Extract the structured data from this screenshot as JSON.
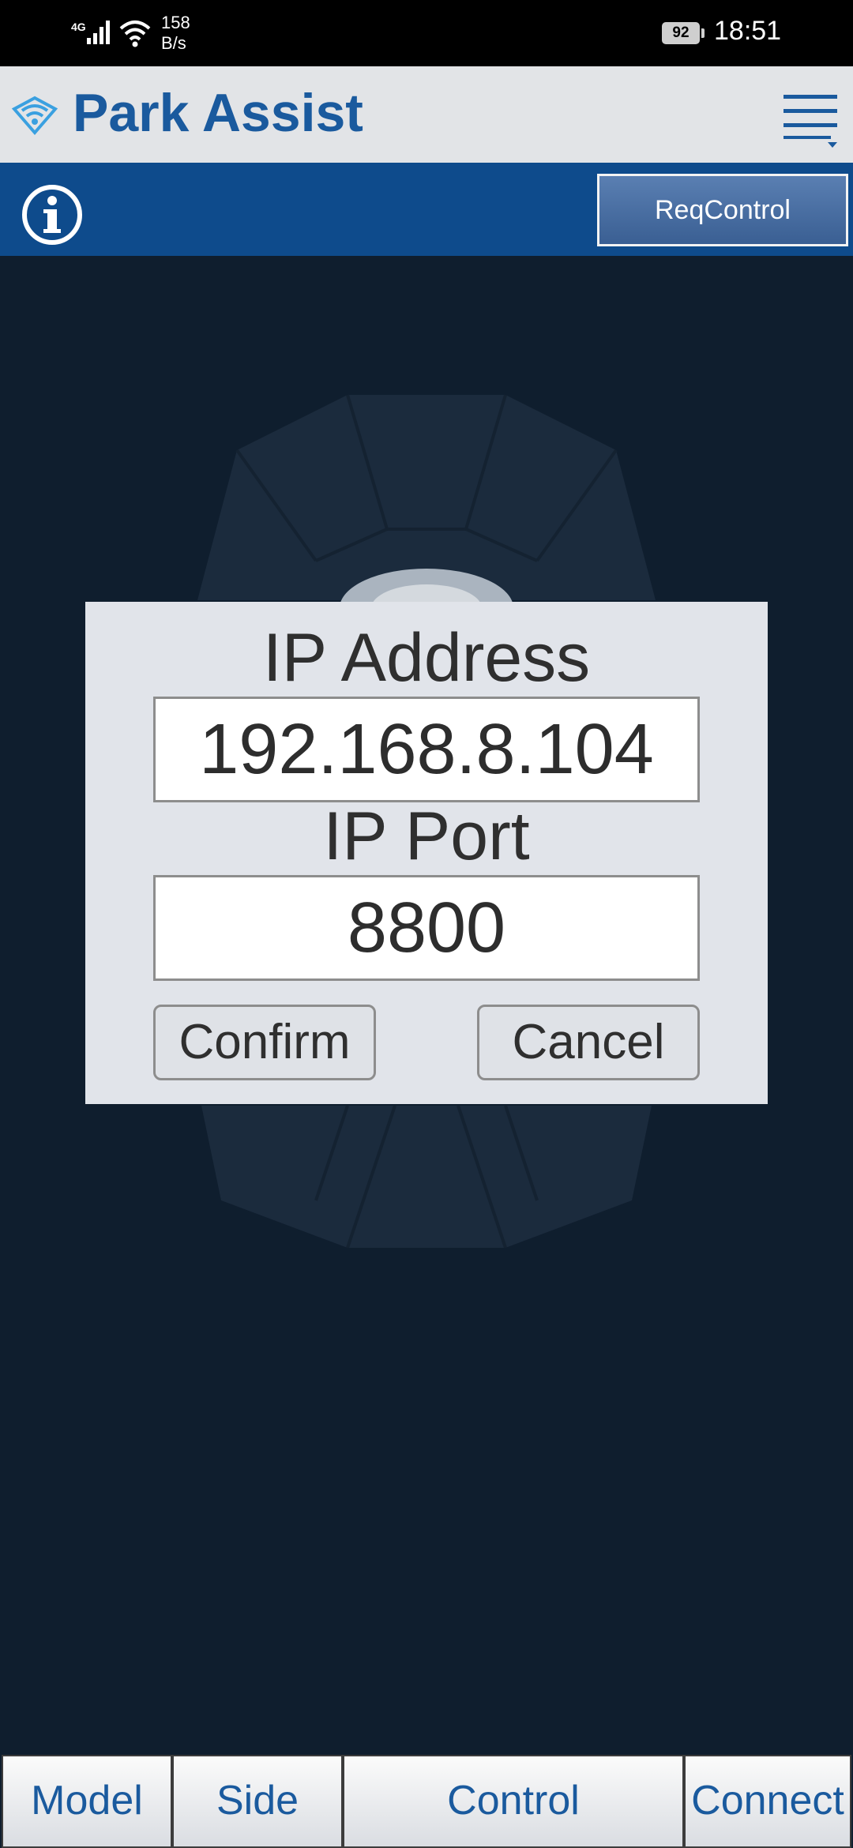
{
  "status_bar": {
    "network": "4G",
    "speed_value": "158",
    "speed_unit": "B/s",
    "battery": "92",
    "time": "18:51"
  },
  "header": {
    "title": "Park Assist",
    "logo_icon": "wifi-diamond-icon",
    "menu_icon": "hamburger-menu-icon"
  },
  "toolbar": {
    "info_icon": "info-circle-icon",
    "req_control_label": "ReqControl"
  },
  "dialog": {
    "ip_address_label": "IP Address",
    "ip_address_value": "192.168.8.104",
    "ip_port_label": "IP Port",
    "ip_port_value": "8800",
    "confirm_label": "Confirm",
    "cancel_label": "Cancel"
  },
  "tabs": [
    {
      "label": "Model"
    },
    {
      "label": "Side"
    },
    {
      "label": "Control"
    },
    {
      "label": "Connect"
    }
  ],
  "colors": {
    "brand_blue": "#1a5a9e",
    "toolbar_blue": "#0e4b8c",
    "background": "#0f1e2e"
  }
}
